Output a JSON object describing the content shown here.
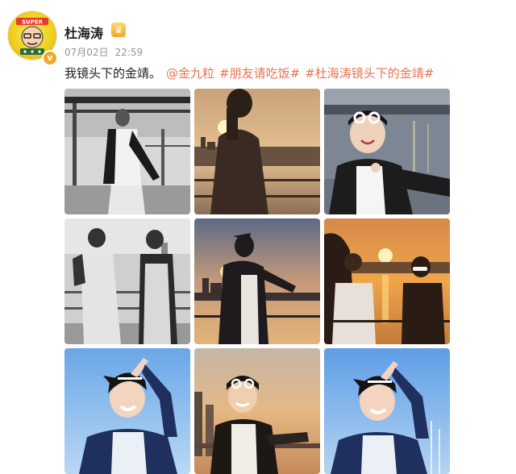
{
  "post": {
    "author": {
      "name": "杜海涛",
      "verified_icon": "verified-v-icon",
      "badge_icon": "crown-icon",
      "verified_mark": "v"
    },
    "date": "07月02日",
    "time": "22:59",
    "text": "我镜头下的金靖。",
    "mention": "@金九粒",
    "tags": [
      "#朋友请吃饭#",
      "#杜海涛镜头下的金靖#"
    ],
    "link_color": "#eb7350",
    "images": [
      {
        "name": "photo-bw-deck",
        "scene": "black and white, woman on ship deck"
      },
      {
        "name": "photo-sunset-silhouette",
        "scene": "sunset silhouette by railing"
      },
      {
        "name": "photo-river-sunglasses",
        "scene": "woman with sunglasses on head by river"
      },
      {
        "name": "photo-bw-two-women",
        "scene": "black and white, two women in overalls"
      },
      {
        "name": "photo-dusk-city",
        "scene": "silhouette against sunset city skyline"
      },
      {
        "name": "photo-sunset-two",
        "scene": "two people at sunset by river"
      },
      {
        "name": "photo-blue-sky-pose-1",
        "scene": "woman posing against blue sky"
      },
      {
        "name": "photo-golden-hour",
        "scene": "woman laughing, golden hour"
      },
      {
        "name": "photo-blue-sky-pose-2",
        "scene": "woman posing against blue sky"
      }
    ]
  }
}
